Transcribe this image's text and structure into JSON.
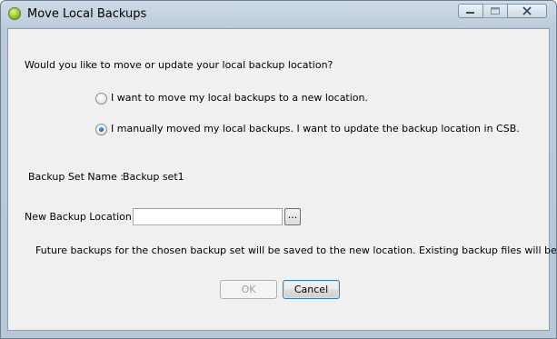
{
  "window": {
    "title": "Move Local Backups"
  },
  "dialog": {
    "question": "Would you like to move or update your local backup location?",
    "options": [
      {
        "label": "I want to move my local backups to a new location.",
        "selected": false
      },
      {
        "label": "I manually moved my local backups. I want to update the backup location in CSB.",
        "selected": true
      }
    ],
    "backup_set_label": "Backup Set Name :",
    "backup_set_value": "Backup set1",
    "location_label": "New Backup Location :",
    "location_value": "",
    "browse_label": "...",
    "info_text": "Future backups for the chosen backup set will be saved to the new location. Existing backup files will be moved.",
    "ok_label": "OK",
    "ok_enabled": false,
    "cancel_label": "Cancel"
  },
  "icons": {
    "app": "green-orb-icon",
    "minimize": "minimize-icon",
    "maximize": "maximize-icon",
    "close": "close-icon"
  }
}
